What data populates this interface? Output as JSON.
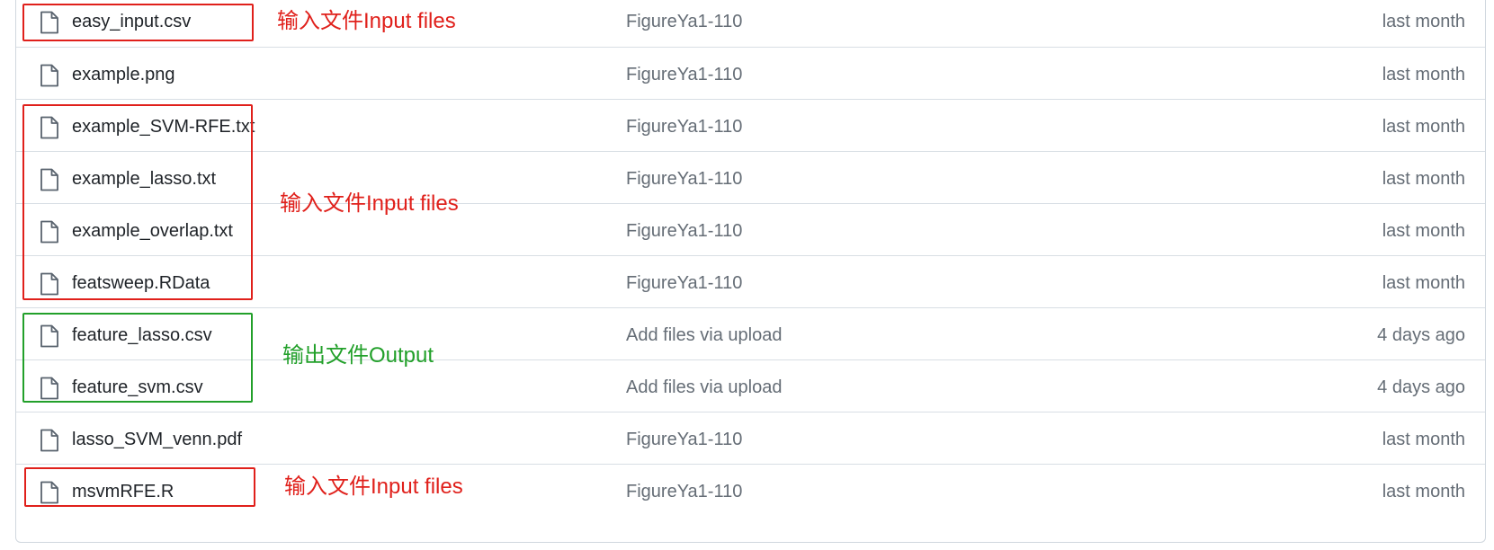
{
  "files": [
    {
      "name": "easy_input.csv",
      "commit": "FigureYa1-110",
      "date": "last month"
    },
    {
      "name": "example.png",
      "commit": "FigureYa1-110",
      "date": "last month"
    },
    {
      "name": "example_SVM-RFE.txt",
      "commit": "FigureYa1-110",
      "date": "last month"
    },
    {
      "name": "example_lasso.txt",
      "commit": "FigureYa1-110",
      "date": "last month"
    },
    {
      "name": "example_overlap.txt",
      "commit": "FigureYa1-110",
      "date": "last month"
    },
    {
      "name": "featsweep.RData",
      "commit": "FigureYa1-110",
      "date": "last month"
    },
    {
      "name": "feature_lasso.csv",
      "commit": "Add files via upload",
      "date": "4 days ago"
    },
    {
      "name": "feature_svm.csv",
      "commit": "Add files via upload",
      "date": "4 days ago"
    },
    {
      "name": "lasso_SVM_venn.pdf",
      "commit": "FigureYa1-110",
      "date": "last month"
    },
    {
      "name": "msvmRFE.R",
      "commit": "FigureYa1-110",
      "date": "last month"
    }
  ],
  "annotations": [
    {
      "text": "输入文件Input files",
      "color": "#e0201b"
    },
    {
      "text": "输入文件Input files",
      "color": "#e0201b"
    },
    {
      "text": "输出文件Output",
      "color": "#22a02a"
    },
    {
      "text": "输入文件Input files",
      "color": "#e0201b"
    }
  ],
  "icons": {
    "file": "file-icon"
  },
  "colors": {
    "input_box": "#e0201b",
    "output_box": "#22a02a",
    "muted_text": "#656d76"
  }
}
